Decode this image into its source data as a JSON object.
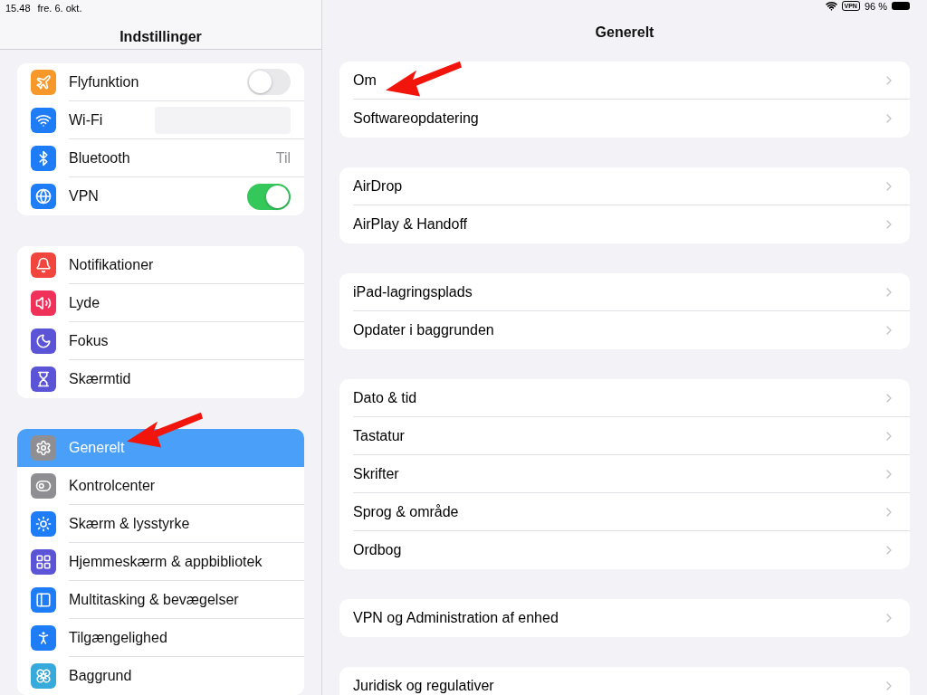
{
  "status_bar": {
    "time": "15.48",
    "date": "fre. 6. okt.",
    "vpn_badge": "VPN",
    "battery": "96 %"
  },
  "sidebar": {
    "title": "Indstillinger",
    "groups": [
      [
        {
          "label": "Flyfunktion",
          "kind": "toggle",
          "on": false,
          "color": "#f7982a",
          "selected": false
        },
        {
          "label": "Wi-Fi",
          "kind": "hidden",
          "color": "#1e7cf7",
          "selected": false
        },
        {
          "label": "Bluetooth",
          "kind": "value",
          "value": "Til",
          "color": "#1e7cf7",
          "selected": false
        },
        {
          "label": "VPN",
          "kind": "toggle",
          "on": true,
          "color": "#1e7cf7",
          "selected": false
        }
      ],
      [
        {
          "label": "Notifikationer",
          "kind": "plain",
          "color": "#f1453d",
          "selected": false
        },
        {
          "label": "Lyde",
          "kind": "plain",
          "color": "#f0325a",
          "selected": false
        },
        {
          "label": "Fokus",
          "kind": "plain",
          "color": "#5b54d6",
          "selected": false
        },
        {
          "label": "Skærmtid",
          "kind": "plain",
          "color": "#5b54d6",
          "selected": false
        }
      ],
      [
        {
          "label": "Generelt",
          "kind": "plain",
          "color": "#8e8e93",
          "selected": true
        },
        {
          "label": "Kontrolcenter",
          "kind": "plain",
          "color": "#8e8e93",
          "selected": false
        },
        {
          "label": "Skærm & lysstyrke",
          "kind": "plain",
          "color": "#1e7cf7",
          "selected": false
        },
        {
          "label": "Hjemmeskærm & appbibliotek",
          "kind": "plain",
          "color": "#5b54d6",
          "selected": false
        },
        {
          "label": "Multitasking & bevægelser",
          "kind": "plain",
          "color": "#1e7cf7",
          "selected": false
        },
        {
          "label": "Tilgængelighed",
          "kind": "plain",
          "color": "#1e7cf7",
          "selected": false
        },
        {
          "label": "Baggrund",
          "kind": "plain",
          "color": "#37aadc",
          "selected": false
        }
      ]
    ]
  },
  "detail": {
    "title": "Generelt",
    "groups": [
      [
        "Om",
        "Softwareopdatering"
      ],
      [
        "AirDrop",
        "AirPlay & Handoff"
      ],
      [
        "iPad-lagringsplads",
        "Opdater i baggrunden"
      ],
      [
        "Dato & tid",
        "Tastatur",
        "Skrifter",
        "Sprog & område",
        "Ordbog"
      ],
      [
        "VPN og Administration af enhed"
      ],
      [
        "Juridisk og regulativer"
      ]
    ]
  }
}
